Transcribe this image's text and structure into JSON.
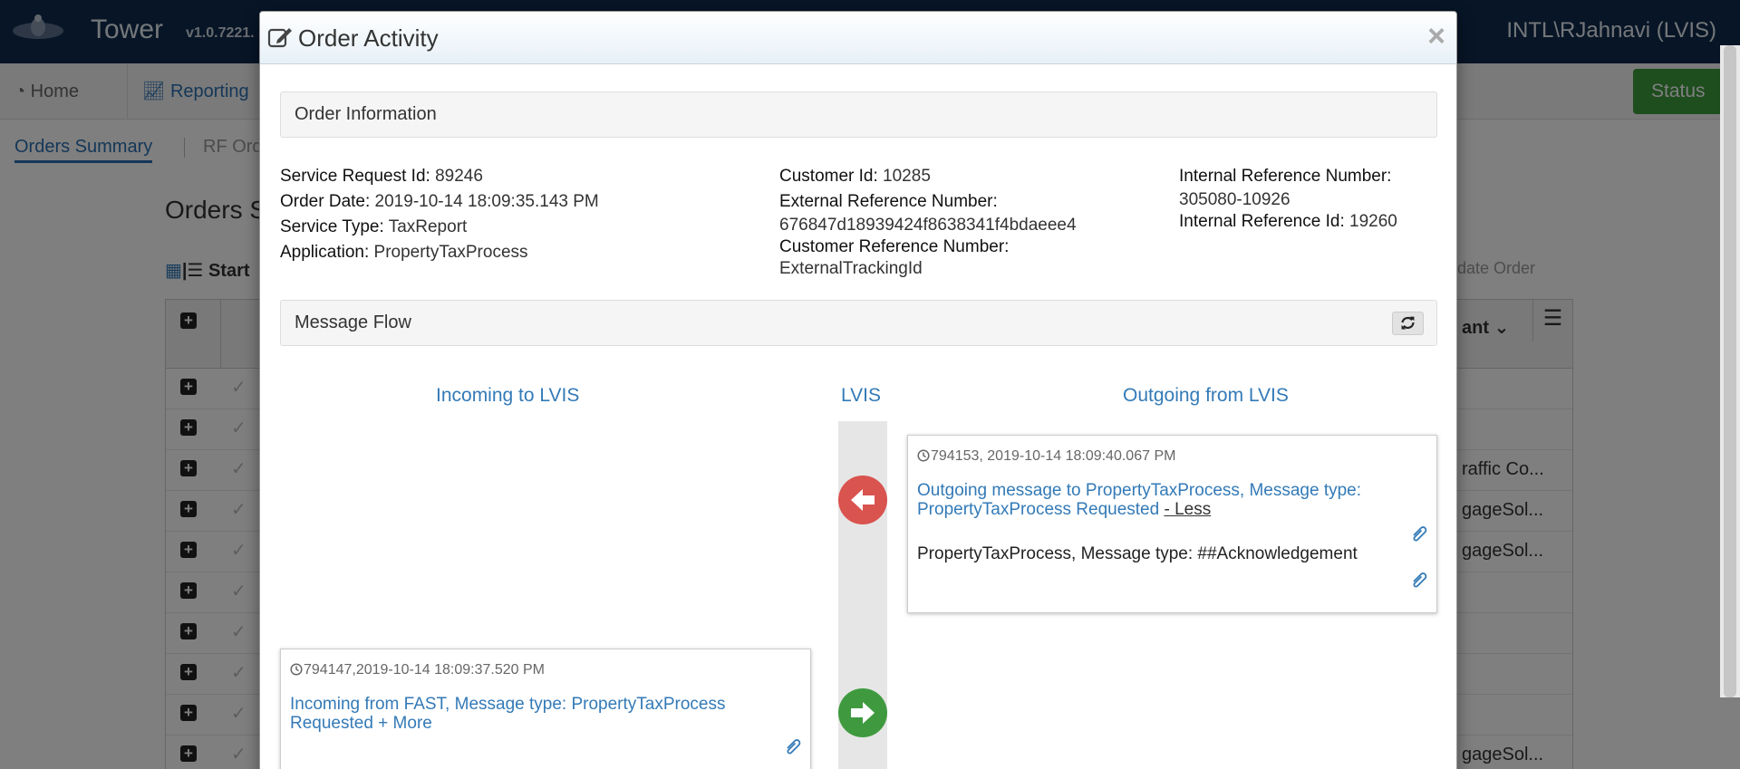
{
  "app": {
    "title": "Tower",
    "version": "v1.0.7221.",
    "user": "INTL\\RJahnavi (LVIS)"
  },
  "nav": {
    "home": "Home",
    "reporting": "Reporting",
    "status": "Status"
  },
  "subnav": {
    "orders_summary": "Orders Summary",
    "rf_orders": "RF Ord"
  },
  "page": {
    "title": "Orders S",
    "start": "Start",
    "validate": "alidate Order",
    "grid_col": "ant",
    "rows_right": [
      "",
      "",
      "raffic Co...",
      "gageSol...",
      "gageSol...",
      "",
      "",
      "",
      "",
      "gageSol..."
    ]
  },
  "modal": {
    "title": "Order Activity",
    "close": "×",
    "order_info_header": "Order Information",
    "message_flow_header": "Message Flow",
    "info": {
      "service_request_id_label": "Service Request Id:",
      "service_request_id": "89246",
      "order_date_label": "Order Date:",
      "order_date": "2019-10-14 18:09:35.143 PM",
      "service_type_label": "Service Type:",
      "service_type": "TaxReport",
      "application_label": "Application:",
      "application": "PropertyTaxProcess",
      "customer_id_label": "Customer Id:",
      "customer_id": "10285",
      "external_ref_label": "External Reference Number:",
      "external_ref": "676847d18939424f8638341f4bdaeee4",
      "customer_ref_label": "Customer Reference Number:",
      "customer_ref": "ExternalTrackingId",
      "internal_ref_number_label": "Internal Reference Number:",
      "internal_ref_number": "305080-10926",
      "internal_ref_id_label": "Internal Reference Id:",
      "internal_ref_id": "19260"
    },
    "flow": {
      "incoming_header": "Incoming to LVIS",
      "lvis_header": "LVIS",
      "outgoing_header": "Outgoing from LVIS",
      "outgoing_message": {
        "meta": "794153, 2019-10-14 18:09:40.067 PM",
        "title": "Outgoing message to PropertyTaxProcess, Message type: PropertyTaxProcess Requested",
        "toggle": "- Less",
        "detail": "PropertyTaxProcess, Message type: ##Acknowledgement"
      },
      "incoming_message": {
        "meta": "794147,2019-10-14 18:09:37.520 PM",
        "title": "Incoming from FAST, Message type: PropertyTaxProcess Requested + More"
      }
    }
  },
  "colors": {
    "topbar": "#0e2a4c",
    "link": "#337ab7",
    "arrow_out": "#d9534f",
    "arrow_in": "#3f9a3f",
    "status": "#3c9a3c"
  }
}
